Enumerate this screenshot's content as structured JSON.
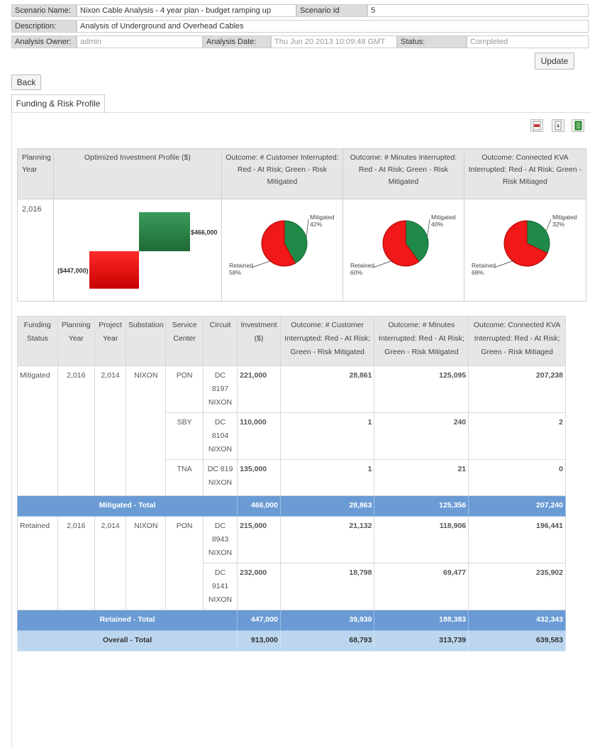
{
  "header": {
    "scenario_name_label": "Scenario Name:",
    "scenario_name": "Nixon Cable Analysis - 4 year plan - budget ramping up",
    "scenario_id_label": "Scenario Id",
    "scenario_id": "5",
    "description_label": "Description:",
    "description": "Analysis of Underground and Overhead Cables",
    "owner_label": "Analysis Owner:",
    "owner": "admin",
    "date_label": "Analysis Date:",
    "date": "Thu Jun 20 2013 10:09:48 GMT",
    "status_label": "Status:",
    "status": "Completed",
    "update_button": "Update"
  },
  "back_button": "Back",
  "tabs": [
    {
      "label": "Funding & Risk Profile",
      "active": true
    }
  ],
  "toolbar_icons": [
    "pdf-export-icon",
    "page-export-icon",
    "excel-export-icon"
  ],
  "profile_table": {
    "headers": {
      "planning_year": "Planning Year",
      "investment": "Optimized Investment Profile ($)",
      "customers": "Outcome: # Customer Interrupted: Red - At Risk; Green - Risk Mitigated",
      "minutes": "Outcome: # Minutes Interrupted: Red - At Risk; Green - Risk Mitigated",
      "kva": "Outcome: Connected KVA Interrupted: Red - At Risk; Green - Risk Mitiaged"
    },
    "year": "2,016",
    "bars": {
      "retained_label": "($447,000)",
      "mitigated_label": "$466,000",
      "retained": -447000,
      "mitigated": 466000
    },
    "pies": [
      {
        "mitigated_label": "Mitigated",
        "mitigated_pct": "42%",
        "retained_label": "Retained",
        "retained_pct": "58%",
        "mitigated": 42
      },
      {
        "mitigated_label": "Mitigated",
        "mitigated_pct": "40%",
        "retained_label": "Retained",
        "retained_pct": "60%",
        "mitigated": 40
      },
      {
        "mitigated_label": "Mitigated",
        "mitigated_pct": "32%",
        "retained_label": "Retained",
        "retained_pct": "68%",
        "mitigated": 32
      }
    ]
  },
  "chart_data": [
    {
      "type": "bar",
      "categories": [
        "Retained",
        "Mitigated"
      ],
      "values": [
        -447000,
        466000
      ]
    },
    {
      "type": "pie",
      "categories": [
        "Mitigated",
        "Retained"
      ],
      "values": [
        42,
        58
      ]
    },
    {
      "type": "pie",
      "categories": [
        "Mitigated",
        "Retained"
      ],
      "values": [
        40,
        60
      ]
    },
    {
      "type": "pie",
      "categories": [
        "Mitigated",
        "Retained"
      ],
      "values": [
        32,
        68
      ]
    }
  ],
  "detail_table": {
    "headers": {
      "status": "Funding Status",
      "year": "Planning Year",
      "project_year": "Project Year",
      "substation": "Substation",
      "service_center": "Service Center",
      "circuit": "Circuit",
      "investment": "Investment ($)",
      "customers": "Outcome: # Customer Interrupted: Red - At Risk; Green - Risk Mitigated",
      "minutes": "Outcome: # Minutes Interrupted: Red - At Risk; Green - Risk Mitigated",
      "kva": "Outcome: Connected KVA Interrupted: Red - At Risk; Green - Risk Mitiaged"
    },
    "mitigated": {
      "status": "Mitigated",
      "year": "2,016",
      "project_year": "2,014",
      "substation": "NIXON",
      "rows": [
        {
          "center": "PON",
          "circuit": "DC 8197 NIXON",
          "investment": "221,000",
          "customers": "28,861",
          "minutes": "125,095",
          "kva": "207,238"
        },
        {
          "center": "SBY",
          "circuit": "DC 8104 NIXON",
          "investment": "110,000",
          "customers": "1",
          "minutes": "240",
          "kva": "2"
        },
        {
          "center": "TNA",
          "circuit": "DC 819 NIXON",
          "investment": "135,000",
          "customers": "1",
          "minutes": "21",
          "kva": "0"
        }
      ],
      "total_label": "Mitigated - Total",
      "total": {
        "investment": "466,000",
        "customers": "28,863",
        "minutes": "125,356",
        "kva": "207,240"
      }
    },
    "retained": {
      "status": "Retained",
      "year": "2,016",
      "project_year": "2,014",
      "substation": "NIXON",
      "center": "PON",
      "rows": [
        {
          "circuit": "DC 8943 NIXON",
          "investment": "215,000",
          "customers": "21,132",
          "minutes": "118,906",
          "kva": "196,441"
        },
        {
          "circuit": "DC 9141 NIXON",
          "investment": "232,000",
          "customers": "18,798",
          "minutes": "69,477",
          "kva": "235,902"
        }
      ],
      "total_label": "Retained - Total",
      "total": {
        "investment": "447,000",
        "customers": "39,930",
        "minutes": "188,383",
        "kva": "432,343"
      }
    },
    "overall_label": "Overall - Total",
    "overall": {
      "investment": "913,000",
      "customers": "68,793",
      "minutes": "313,739",
      "kva": "639,583"
    }
  }
}
